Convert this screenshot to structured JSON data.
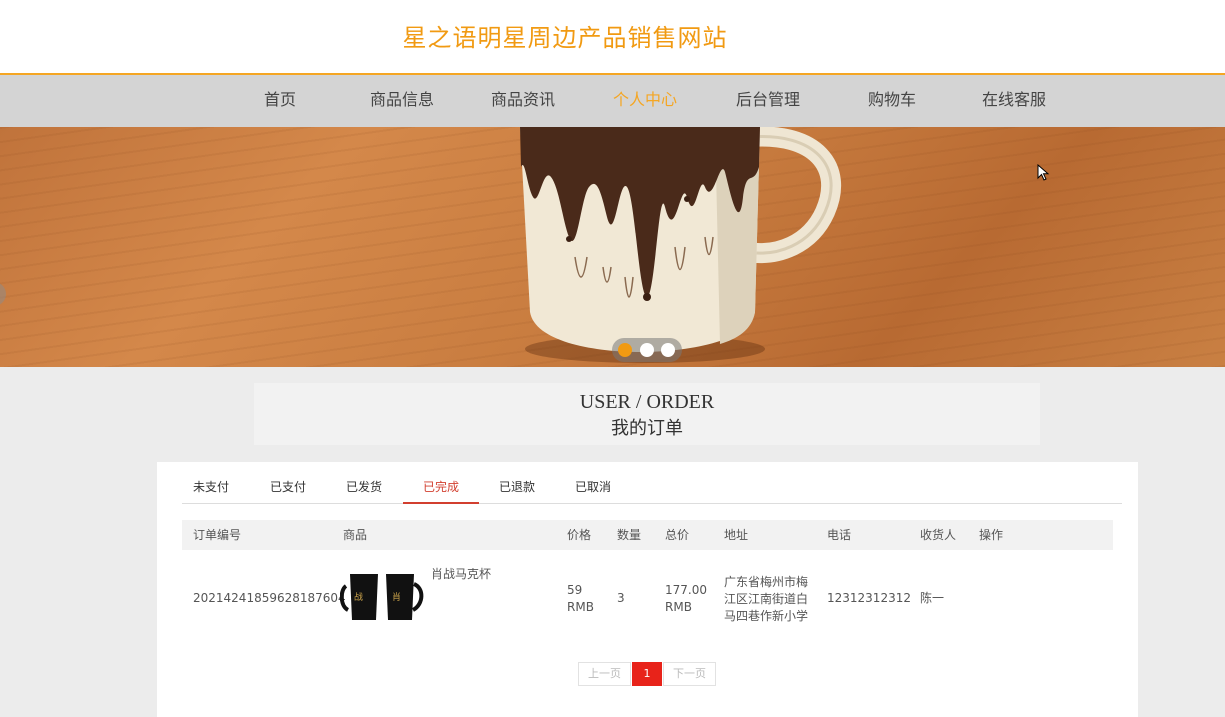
{
  "header": {
    "title": "星之语明星周边产品销售网站"
  },
  "nav": {
    "items": [
      {
        "label": "首页"
      },
      {
        "label": "商品信息"
      },
      {
        "label": "商品资讯"
      },
      {
        "label": "个人中心",
        "active": true
      },
      {
        "label": "后台管理"
      },
      {
        "label": "购物车"
      },
      {
        "label": "在线客服"
      }
    ],
    "accent": "#f5a623"
  },
  "carousel": {
    "slide_count": 3,
    "active_index": 0
  },
  "section": {
    "title_en": "USER / ORDER",
    "title_cn": "我的订单"
  },
  "tabs": [
    {
      "label": "未支付"
    },
    {
      "label": "已支付"
    },
    {
      "label": "已发货"
    },
    {
      "label": "已完成",
      "active": true
    },
    {
      "label": "已退款"
    },
    {
      "label": "已取消"
    }
  ],
  "table": {
    "headers": [
      "订单编号",
      "商品",
      "价格",
      "数量",
      "总价",
      "地址",
      "电话",
      "收货人",
      "操作"
    ],
    "rows": [
      {
        "order_no": "20214241859628187604",
        "product": "肖战马克杯",
        "price": "59 RMB",
        "quantity": "3",
        "total": "177.00 RMB",
        "address": "广东省梅州市梅江区江南街道白马四巷作新小学",
        "phone": "12312312312",
        "receiver": "陈一"
      }
    ]
  },
  "pagination": {
    "prev": "上一页",
    "current": "1",
    "next": "下一页"
  },
  "colors": {
    "title": "#f19a12",
    "tab_active": "#d23f2f",
    "page_active": "#e8231a"
  }
}
